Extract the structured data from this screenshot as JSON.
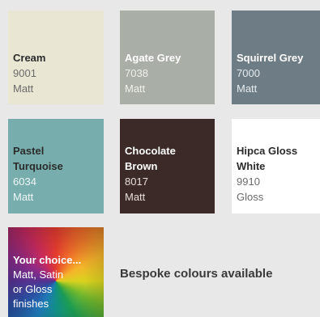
{
  "tiles": [
    {
      "name": "Cream",
      "code": "9001",
      "finish": "Matt",
      "bg": "#eae6d4",
      "fg": "#2b2b2b"
    },
    {
      "name": "Agate Grey",
      "code": "7038",
      "finish": "Matt",
      "bg": "#a9aea6",
      "fg": "#ffffff"
    },
    {
      "name": "Squirrel Grey",
      "code": "7000",
      "finish": "Matt",
      "bg": "#6e7c85",
      "fg": "#ffffff"
    },
    {
      "name_line1": "Pastel",
      "name_line2": "Turquoise",
      "code": "6034",
      "finish": "Matt",
      "bg": "#78adad",
      "fg": "#2b2b2b"
    },
    {
      "name_line1": "Chocolate",
      "name_line2": "Brown",
      "code": "8017",
      "finish": "Matt",
      "bg": "#3b2a27",
      "fg": "#ffffff"
    },
    {
      "name_line1": "Hipca Gloss",
      "name_line2": "White",
      "code": "9910",
      "finish": "Gloss",
      "bg": "#ffffff",
      "fg": "#2b2b2b"
    }
  ],
  "custom": {
    "title": "Your choice...",
    "line1": "Matt, Satin",
    "line2": "or Gloss",
    "line3": "finishes"
  },
  "bespoke_text": "Bespoke colours available"
}
